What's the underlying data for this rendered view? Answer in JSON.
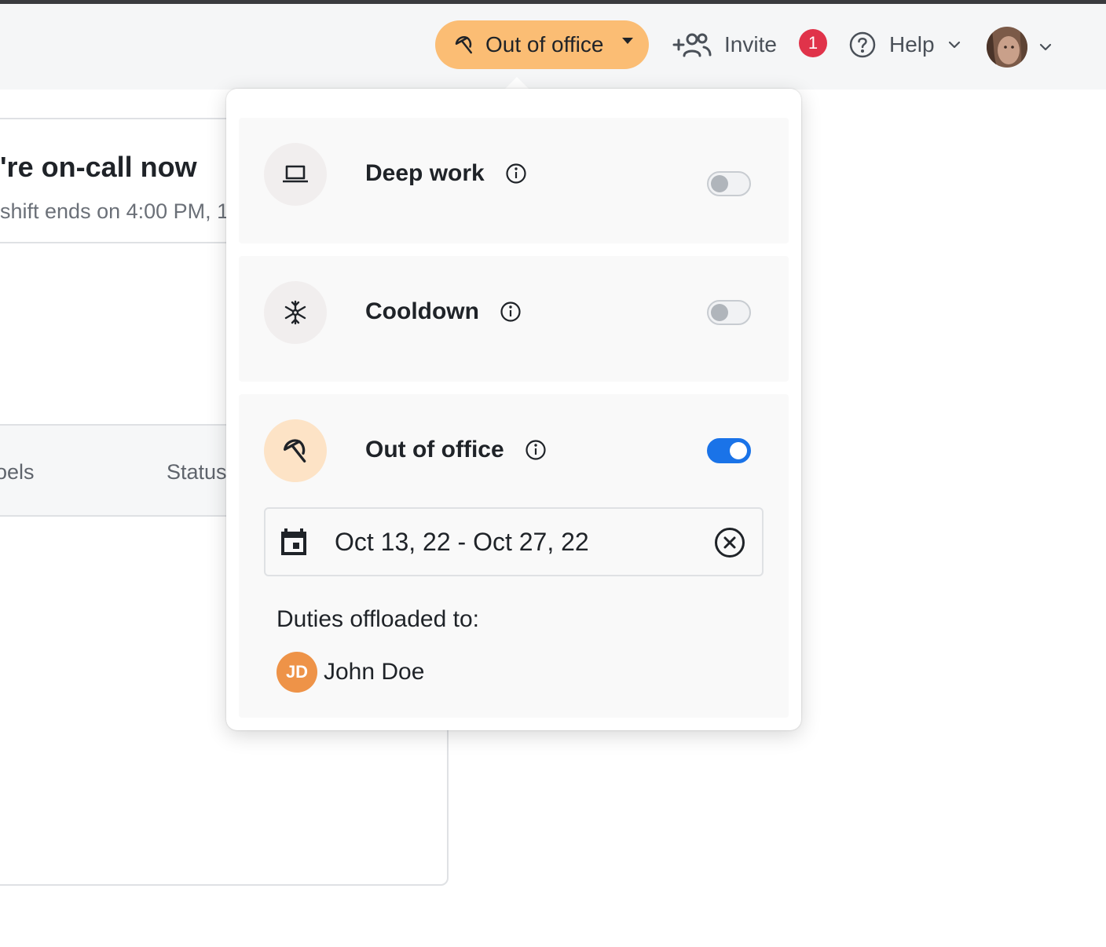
{
  "header": {
    "status_button": {
      "label": "Out of office",
      "color": "#fbbd74"
    },
    "invite": {
      "label": "Invite",
      "badge_count": "1"
    },
    "help": {
      "label": "Help"
    },
    "avatar": {
      "icon": "user-avatar"
    }
  },
  "background": {
    "oncall_title": "'re on-call now",
    "oncall_subtitle": "shift ends on 4:00 PM, 1",
    "columns": [
      "oels",
      "Status"
    ]
  },
  "popover": {
    "modes": [
      {
        "label": "Deep work",
        "icon": "laptop-icon",
        "enabled": false
      },
      {
        "label": "Cooldown",
        "icon": "snowflake-icon",
        "enabled": false
      },
      {
        "label": "Out of office",
        "icon": "umbrella-icon",
        "enabled": true
      }
    ],
    "out_of_office": {
      "date_range": "Oct 13, 22 - Oct 27, 22",
      "duties_label": "Duties offloaded to:",
      "assignee_initials": "JD",
      "assignee_name": "John Doe"
    },
    "toggle_on_color": "#1a73e8"
  }
}
